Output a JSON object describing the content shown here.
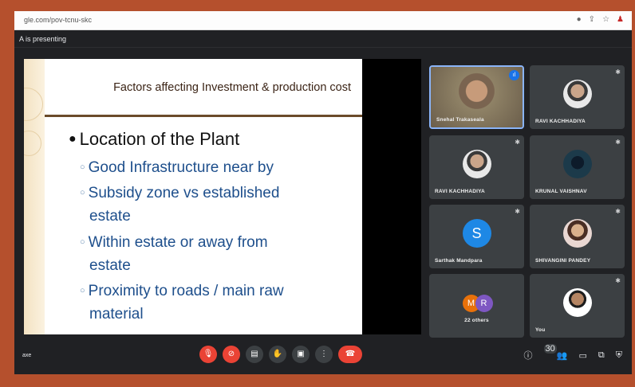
{
  "browser": {
    "url": "gle.com/pov-tcnu-skc",
    "icons": [
      "key-icon",
      "share-icon",
      "star-icon",
      "profile-icon"
    ]
  },
  "presenting_banner": "A is presenting",
  "slide": {
    "title": "Factors affecting Investment & production cost",
    "bullet": "Location of the Plant",
    "subs": [
      {
        "line1": "Good Infrastructure near by",
        "line2": ""
      },
      {
        "line1": "Subsidy zone vs established",
        "line2": "estate"
      },
      {
        "line1": "Within estate or away from",
        "line2": "estate"
      },
      {
        "line1": "Proximity to roads / main raw",
        "line2": "material"
      }
    ]
  },
  "participants": [
    {
      "name": "Snehal Trakaseala",
      "type": "video",
      "speaking": true
    },
    {
      "name": "RAVI KACHHADIYA",
      "type": "photo"
    },
    {
      "name": "RAVI KACHHADIYA",
      "type": "photo"
    },
    {
      "name": "KRUNAL VAISHNAV",
      "type": "photo"
    },
    {
      "name": "Sarthak Mandpara",
      "type": "letter",
      "letter": "S"
    },
    {
      "name": "SHIVANGINI PANDEY",
      "type": "photo"
    },
    {
      "name": "22 others",
      "type": "others",
      "letters": [
        "M",
        "R"
      ]
    },
    {
      "name": "You",
      "type": "photo"
    }
  ],
  "bottom": {
    "meeting_code": "axe",
    "participant_count": "30",
    "controls": [
      "mic-off",
      "camera-off",
      "captions",
      "raise-hand",
      "present",
      "more",
      "leave-call"
    ],
    "right_controls": [
      "info",
      "people",
      "chat",
      "activities",
      "host-controls"
    ]
  },
  "colors": {
    "accent": "#1a73e8",
    "danger": "#ea4335",
    "background": "#202124",
    "frame": "#b5502d"
  }
}
